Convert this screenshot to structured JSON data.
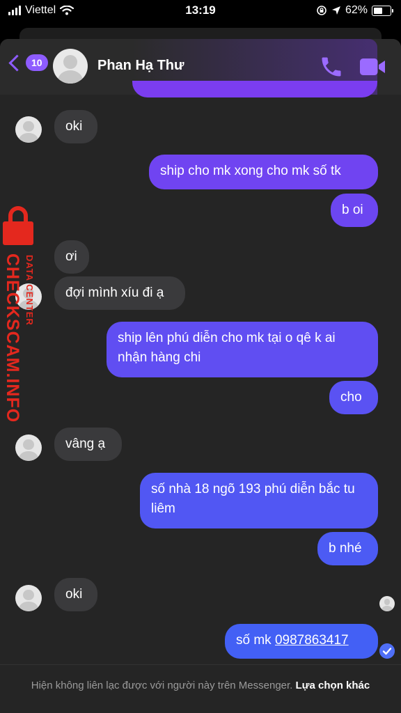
{
  "status_bar": {
    "carrier": "Viettel",
    "time": "13:19",
    "battery_text": "62%",
    "battery_level": 0.62
  },
  "header": {
    "unread_count": "10",
    "contact_name": "Phan Hạ Thư"
  },
  "messages": [
    {
      "side": "in",
      "text": "oki"
    },
    {
      "side": "out",
      "text": "ship cho mk xong cho mk số tk"
    },
    {
      "side": "out",
      "text": "b oi"
    },
    {
      "side": "in",
      "text": "ơi"
    },
    {
      "side": "in",
      "text": "đợi mình xíu đi ạ"
    },
    {
      "side": "out",
      "text": "ship lên phú diễn cho mk tại o qê k ai nhận hàng chi"
    },
    {
      "side": "out",
      "text": "cho"
    },
    {
      "side": "in",
      "text": "vâng ạ"
    },
    {
      "side": "out",
      "text": "số nhà 18 ngõ 193 phú diễn bắc tu liêm"
    },
    {
      "side": "out",
      "text": "b nhé"
    },
    {
      "side": "in",
      "text": "oki"
    },
    {
      "side": "out",
      "text_prefix": "số mk ",
      "phone": "0987863417"
    }
  ],
  "watermark": {
    "line1": "DATA CENTER",
    "line2": "CHECKSCAM.INFO"
  },
  "footer": {
    "notice": "Hiện không liên lạc được với người này trên Messenger.",
    "link": "Lựa chọn khác"
  },
  "colors": {
    "accent": "#8e5cff",
    "outgoing_top": "#7b3df0",
    "outgoing_bottom": "#3f63f5",
    "incoming": "#3a3a3c",
    "watermark": "#e4281e"
  }
}
